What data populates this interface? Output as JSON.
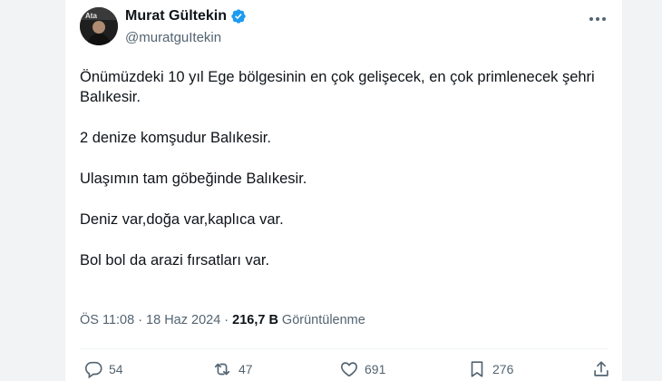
{
  "author": {
    "display_name": "Murat Gültekin",
    "handle": "@muratguItekin",
    "verified": true,
    "avatar_badge_text": "Ata"
  },
  "tweet": {
    "paragraphs": [
      "Önümüzdeki 10 yıl Ege bölgesinin en çok gelişecek, en çok primlenecek şehri Balıkesir.",
      "2 denize komşudur Balıkesir.",
      "Ulaşımın tam göbeğinde Balıkesir.",
      "Deniz var,doğa var,kaplıca var.",
      "Bol bol da arazi fırsatları var."
    ]
  },
  "meta": {
    "time": "ÖS 11:08",
    "separator": "·",
    "date": "18 Haz 2024",
    "views_count": "216,7 B",
    "views_label": "Görüntülenme"
  },
  "actions": {
    "replies": "54",
    "retweets": "47",
    "likes": "691",
    "bookmarks": "276"
  },
  "icons": {
    "verified": "verified-badge-icon",
    "more": "more-icon",
    "reply": "reply-icon",
    "retweet": "retweet-icon",
    "like": "heart-icon",
    "bookmark": "bookmark-icon",
    "share": "share-icon"
  },
  "colors": {
    "verified_blue": "#1d9bf0",
    "text_primary": "#0f1419",
    "text_secondary": "#536471",
    "background": "#ffffff",
    "page_background": "#f2f3f4"
  }
}
